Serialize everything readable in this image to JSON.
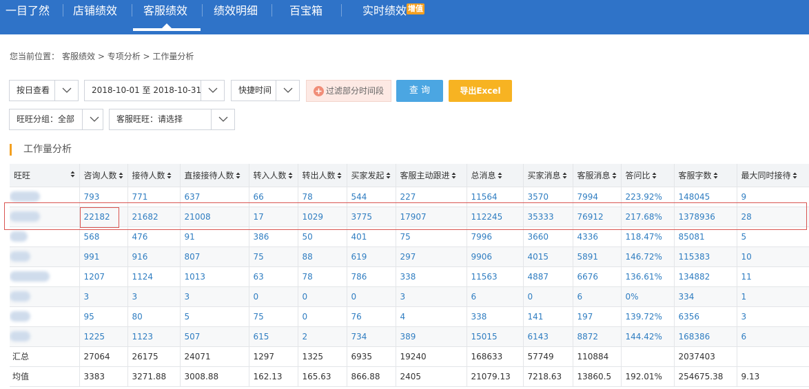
{
  "nav": {
    "items": [
      "一目了然",
      "店铺绩效",
      "客服绩效",
      "绩效明细",
      "百宝箱",
      "实时绩效"
    ],
    "active": "客服绩效",
    "badge": "增值"
  },
  "breadcrumb": {
    "prefix": "您当前位置：",
    "path": "客服绩效 > 专项分析 > 工作量分析"
  },
  "filters": {
    "view_mode": "按日查看",
    "date_range": "2018-10-01 至 2018-10-31",
    "quick_time": "快捷时间",
    "filter_period": "过滤部分时间段",
    "query": "查 询",
    "export": "导出Excel",
    "ww_group": "旺旺分组：全部",
    "cs_ww": "客服旺旺：请选择"
  },
  "section": {
    "title": "工作量分析"
  },
  "table": {
    "headers": [
      "旺旺",
      "咨询人数",
      "接待人数",
      "直接接待人数",
      "转入人数",
      "转出人数",
      "买家发起",
      "客服主动跟进",
      "总消息",
      "买家消息",
      "客服消息",
      "答问比",
      "客服字数",
      "最大同时接待"
    ],
    "rows": [
      [
        "",
        "793",
        "771",
        "637",
        "66",
        "78",
        "544",
        "227",
        "11564",
        "3570",
        "7994",
        "223.92%",
        "148045",
        "9"
      ],
      [
        "",
        "22182",
        "21682",
        "21008",
        "17",
        "1029",
        "3775",
        "17907",
        "112245",
        "35333",
        "76912",
        "217.68%",
        "1378936",
        "28"
      ],
      [
        "",
        "568",
        "476",
        "91",
        "386",
        "50",
        "401",
        "75",
        "7996",
        "3660",
        "4336",
        "118.47%",
        "85081",
        "5"
      ],
      [
        "",
        "991",
        "916",
        "807",
        "75",
        "88",
        "619",
        "297",
        "9906",
        "4015",
        "5891",
        "146.72%",
        "115383",
        "10"
      ],
      [
        "",
        "1207",
        "1124",
        "1013",
        "63",
        "78",
        "786",
        "338",
        "11563",
        "4887",
        "6676",
        "136.61%",
        "134882",
        "11"
      ],
      [
        "",
        "3",
        "3",
        "3",
        "0",
        "0",
        "0",
        "3",
        "6",
        "0",
        "6",
        "0%",
        "334",
        "1"
      ],
      [
        "",
        "95",
        "80",
        "5",
        "75",
        "0",
        "76",
        "4",
        "338",
        "141",
        "197",
        "139.72%",
        "6356",
        "3"
      ],
      [
        "",
        "1225",
        "1123",
        "507",
        "615",
        "2",
        "734",
        "389",
        "15015",
        "6143",
        "8872",
        "144.42%",
        "168386",
        "6"
      ]
    ],
    "summary": [
      [
        "汇总",
        "27064",
        "26175",
        "24071",
        "1297",
        "1325",
        "6935",
        "19240",
        "168633",
        "57749",
        "110884",
        "",
        "2037403",
        ""
      ],
      [
        "均值",
        "3383",
        "3271.88",
        "3008.88",
        "162.13",
        "165.63",
        "866.88",
        "2405",
        "21079.13",
        "7218.63",
        "13860.5",
        "192.01%",
        "254675.38",
        "9.13"
      ]
    ]
  },
  "colors": {
    "nav_bg": "#2f73c8",
    "link_blue": "#2f7dc1",
    "query_btn": "#4ba6e2",
    "export_btn": "#f7b322",
    "highlight": "#d9534f",
    "section_accent": "#f4a020"
  }
}
